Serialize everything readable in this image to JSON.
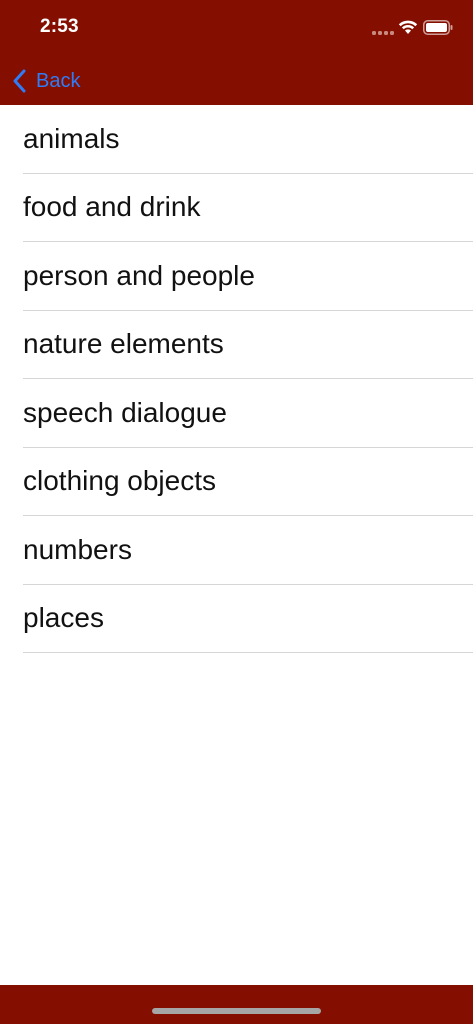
{
  "status_bar": {
    "time": "2:53",
    "icons": [
      "signal-icon",
      "wifi-icon",
      "battery-icon"
    ]
  },
  "nav": {
    "back_label": "Back",
    "back_icon": "chevron-left-icon"
  },
  "categories": [
    {
      "label": "animals"
    },
    {
      "label": "food and drink"
    },
    {
      "label": "person and people"
    },
    {
      "label": "nature elements"
    },
    {
      "label": "speech dialogue"
    },
    {
      "label": "clothing objects"
    },
    {
      "label": "numbers"
    },
    {
      "label": "places"
    }
  ],
  "colors": {
    "bar_background": "#840E00",
    "accent_blue": "#2F7CF6",
    "separator": "#D6D6D6",
    "text": "#111111"
  }
}
